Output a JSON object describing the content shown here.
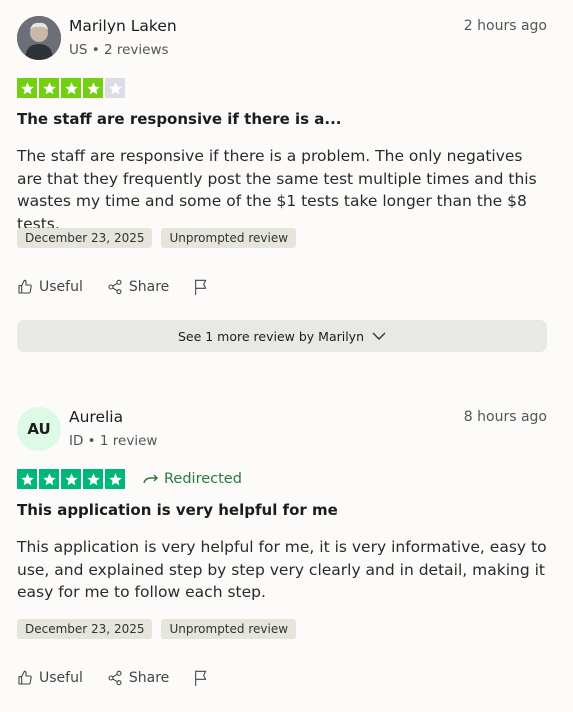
{
  "reviews": [
    {
      "name": "Marilyn Laken",
      "meta": "US • 2 reviews",
      "time": "2 hours ago",
      "rating": 4,
      "title": "The staff are responsive if there is a...",
      "body": "The staff are responsive if there is a problem. The only negatives are that they frequently post the same test multiple times and this wastes my time and some of the $1 tests take longer than the $8 tests.",
      "date": "December 23, 2025",
      "tag": "Unprompted review",
      "useful_label": "Useful",
      "share_label": "Share"
    },
    {
      "name": "Aurelia",
      "initials": "AU",
      "meta": "ID • 1 review",
      "time": "8 hours ago",
      "rating": 5,
      "redirected_label": "Redirected",
      "title": "This application is very helpful for me",
      "body": "This application is very helpful for me, it is very informative, easy to use, and explained step by step very clearly and in detail, making it easy for me to follow each step.",
      "date": "December 23, 2025",
      "tag": "Unprompted review",
      "useful_label": "Useful",
      "share_label": "Share"
    }
  ],
  "see_more": {
    "label": "See 1 more review by Marilyn"
  },
  "colors": {
    "star_four": "#73cf11",
    "star_five": "#00b67a",
    "star_off": "#dcdce6",
    "avatar_initials_bg": "#dcfae5"
  },
  "icons": [
    "star-icon",
    "redirect-arrow-icon",
    "thumbs-up-icon",
    "share-icon",
    "flag-icon",
    "chevron-down-icon"
  ]
}
